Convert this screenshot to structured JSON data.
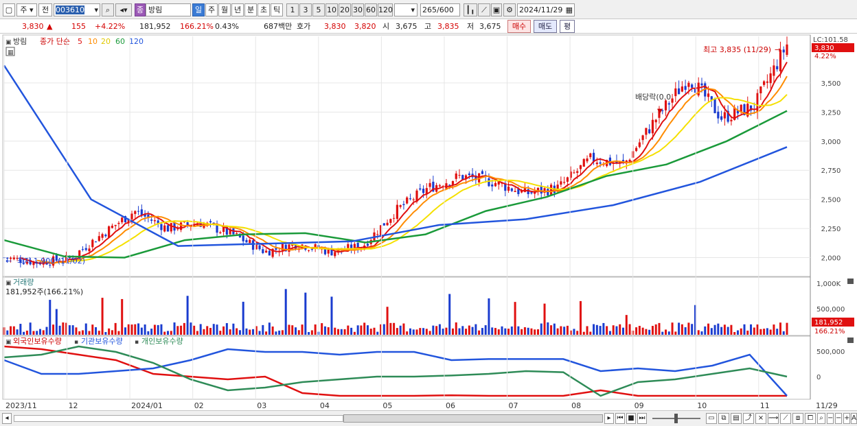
{
  "toolbar": {
    "market": "주",
    "prefix": "전",
    "code": "003610",
    "name_badge": "종",
    "name": "방림",
    "periods": [
      "일",
      "주",
      "월",
      "년",
      "분",
      "초",
      "틱"
    ],
    "active_period": "일",
    "counts": [
      "1",
      "3",
      "5",
      "10",
      "20",
      "30",
      "60",
      "120"
    ],
    "range": "265",
    "range_total": "/600",
    "date": "2024/11/29"
  },
  "quote": {
    "price": "3,830",
    "change_arrow": "▲",
    "change": "155",
    "change_pct": "+4.22%",
    "volume": "181,952",
    "volume_ratio": "166.21%",
    "turnover": "0.43%",
    "amount": "687백만",
    "bid_ask_label": "호가",
    "ask": "3,830",
    "bid": "3,820",
    "open_label": "시",
    "open": "3,675",
    "high_label": "고",
    "high": "3,835",
    "low_label": "저",
    "low": "3,675",
    "buy_label": "매수",
    "sell_label": "매도",
    "eval_label": "평"
  },
  "legend": {
    "stock": "방림",
    "ma_title": "종가 단순",
    "ma_periods": [
      "5",
      "10",
      "20",
      "60",
      "120"
    ],
    "ma_colors": [
      "#e01010",
      "#ff8c00",
      "#f5e000",
      "#1a9a3a",
      "#2255dd"
    ]
  },
  "annotations": {
    "high_label": "최고 3,835 (11/29)",
    "low_label": "최저 1,900 (11/02)",
    "dividend": "배당락(0.0"
  },
  "price_axis": {
    "top_label": "LC:101.58",
    "current": "3,830",
    "current_pct": "4.22%",
    "ticks": [
      "3,500",
      "3,250",
      "3,000",
      "2,750",
      "2,500",
      "2,250",
      "2,000"
    ]
  },
  "volume_panel": {
    "title": "거래량",
    "value": "181,952주(166.21%)",
    "ticks": [
      "1,000K",
      "500,000"
    ],
    "current": "181,952",
    "current_pct": "166.21%"
  },
  "holding_panel": {
    "series": [
      "외국인보유수량",
      "기관보유수량",
      "개인보유수량"
    ],
    "colors": [
      "#e01010",
      "#2255dd",
      "#2e8b57"
    ],
    "ticks": [
      "500,000",
      "0"
    ]
  },
  "x_axis": {
    "labels": [
      "2023/11",
      "12",
      "2024/01",
      "02",
      "03",
      "04",
      "05",
      "06",
      "07",
      "08",
      "09",
      "10",
      "11"
    ],
    "last": "11/29"
  },
  "chart_data": {
    "type": "candlestick",
    "title": "방림",
    "y_ticks": [
      2000,
      2250,
      2500,
      2750,
      3000,
      3250,
      3500
    ],
    "ylim": [
      1850,
      3900
    ],
    "high": 3835,
    "low": 1900,
    "last_close": 3830,
    "close_path": [
      [
        "2023/11",
        2000
      ],
      [
        "2023/12",
        1960
      ],
      [
        "2023/12 end",
        1990
      ],
      [
        "2024/01",
        2200
      ],
      [
        "2024/01 mid",
        2400
      ],
      [
        "2024/02",
        2250
      ],
      [
        "2024/02 mid",
        2300
      ],
      [
        "2024/03",
        2200
      ],
      [
        "2024/03 mid",
        2050
      ],
      [
        "2024/04",
        2120
      ],
      [
        "2024/04 mid",
        2050
      ],
      [
        "2024/05",
        2100
      ],
      [
        "2024/05 end",
        2400
      ],
      [
        "2024/06",
        2600
      ],
      [
        "2024/06 end",
        2700
      ],
      [
        "2024/07",
        2650
      ],
      [
        "2024/07 end",
        2550
      ],
      [
        "2024/08",
        2600
      ],
      [
        "2024/08 mid",
        2850
      ],
      [
        "2024/09",
        2800
      ],
      [
        "2024/09 end",
        3200
      ],
      [
        "2024/10",
        3550
      ],
      [
        "2024/10 end",
        3200
      ],
      [
        "2024/11",
        3300
      ],
      [
        "2024/11/29",
        3830
      ]
    ],
    "ma120_path": [
      [
        "2023/11",
        3650
      ],
      [
        "2023/12",
        2500
      ],
      [
        "2024/01",
        2100
      ],
      [
        "2024/03",
        2120
      ],
      [
        "2024/05",
        2140
      ],
      [
        "2024/07",
        2280
      ],
      [
        "2024/08",
        2330
      ],
      [
        "2024/09",
        2450
      ],
      [
        "2024/10",
        2650
      ],
      [
        "2024/11/29",
        2950
      ]
    ],
    "ma60_path": [
      [
        "2023/11",
        2150
      ],
      [
        "2023/12",
        2010
      ],
      [
        "2024/01",
        2000
      ],
      [
        "2024/02",
        2150
      ],
      [
        "2024/03",
        2200
      ],
      [
        "2024/04",
        2210
      ],
      [
        "2024/05",
        2130
      ],
      [
        "2024/06",
        2200
      ],
      [
        "2024/07",
        2400
      ],
      [
        "2024/08",
        2520
      ],
      [
        "2024/09",
        2700
      ],
      [
        "2024/10",
        2800
      ],
      [
        "2024/10 end",
        3000
      ],
      [
        "2024/11/29",
        3260
      ]
    ]
  }
}
